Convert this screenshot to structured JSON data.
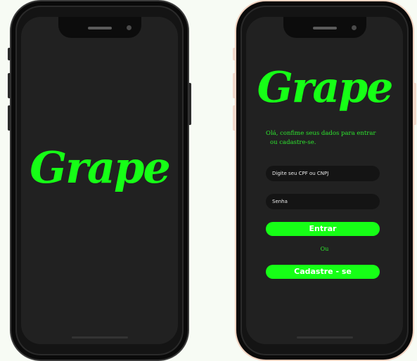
{
  "splash": {
    "logo": "Grape"
  },
  "login": {
    "logo": "Grape",
    "message_line1": "Olá, confime seus dados para entrar",
    "message_line2": "ou  cadastre-se.",
    "cpf_placeholder": "Digite seu CPF ou CNPJ",
    "password_placeholder": "Senha",
    "login_button": "Entrar",
    "or_text": "Ou",
    "signup_button": "Cadastre - se"
  },
  "colors": {
    "accent": "#16ff16",
    "screen": "#212121",
    "field": "#141414"
  }
}
